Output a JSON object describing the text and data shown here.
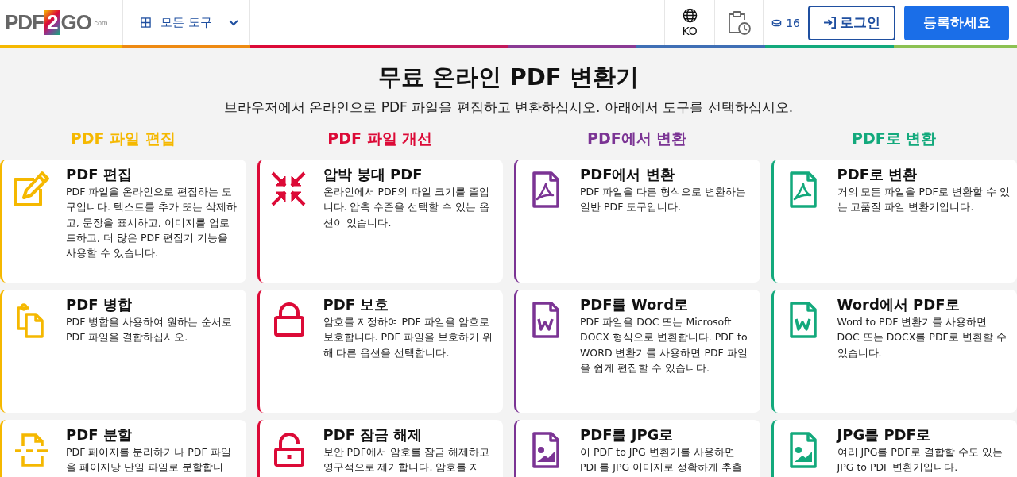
{
  "header": {
    "logo": {
      "text_before": "PDF",
      "badge": "2",
      "text_after": "GO",
      "suffix": ".com"
    },
    "tools_menu": "모든 도구",
    "language": "KO",
    "credits": "16",
    "login": "로그인",
    "signup": "등록하세요"
  },
  "hero": {
    "title": "무료 온라인 PDF 변환기",
    "subtitle": "브라우저에서 온라인으로 PDF 파일을 편집하고 변환하십시오. 아래에서 도구를 선택하십시오."
  },
  "columns": [
    {
      "title": "PDF 파일 편집",
      "color": "#f5b800",
      "tools": [
        {
          "kind": "edit",
          "title": "PDF 편집",
          "description": "PDF 파일을 온라인으로 편집하는 도구입니다. 텍스트를 추가 또는 삭제하고, 문장을 표시하고, 이미지를 업로드하고, 더 많은 PDF 편집기 기능을 사용할 수 있습니다."
        },
        {
          "kind": "merge",
          "title": "PDF 병합",
          "description": "PDF 병합을 사용하여 원하는 순서로 PDF 파일을 결합하십시오."
        },
        {
          "kind": "split",
          "title": "PDF 분할",
          "description": "PDF 페이지를 분리하거나 PDF 파일을 페이지당 단일 파일로 분할합니"
        }
      ]
    },
    {
      "title": "PDF 파일 개선",
      "color": "#dc0a37",
      "tools": [
        {
          "kind": "compress",
          "title": "압박 붕대 PDF",
          "description": "온라인에서 PDF의 파일 크기를 줄입니다. 압축 수준을 선택할 수 있는 옵션이 있습니다."
        },
        {
          "kind": "lock",
          "title": "PDF 보호",
          "description": "암호를 지정하여 PDF 파일을 암호로 보호합니다. PDF 파일을 보호하기 위해 다른 옵션을 선택합니다."
        },
        {
          "kind": "unlock",
          "title": "PDF 잠금 해제",
          "description": "보안 PDF에서 암호를 잠금 해제하고 영구적으로 제거합니다. 암호를 지"
        }
      ]
    },
    {
      "title": "PDF에서 변환",
      "color": "#7b3494",
      "tools": [
        {
          "kind": "pdf",
          "title": "PDF에서 변환",
          "description": "PDF 파일을 다른 형식으로 변환하는 일반 PDF 도구입니다."
        },
        {
          "kind": "word",
          "title": "PDF를 Word로",
          "description": "PDF 파일을 DOC 또는 Microsoft DOCX 형식으로 변환합니다. PDF to WORD 변환기를 사용하면 PDF 파일을 쉽게 편집할 수 있습니다."
        },
        {
          "kind": "image",
          "title": "PDF를 JPG로",
          "description": "이 PDF to JPG 변환기를 사용하면 PDF를 JPG 이미지로 정확하게 추출"
        }
      ]
    },
    {
      "title": "PDF로 변환",
      "color": "#13a97c",
      "tools": [
        {
          "kind": "pdf",
          "title": "PDF로 변환",
          "description": "거의 모든 파일을 PDF로 변환할 수 있는 고품질 파일 변환기입니다."
        },
        {
          "kind": "word",
          "title": "Word에서 PDF로",
          "description": "Word to PDF 변환기를 사용하면 DOC 또는 DOCX를 PDF로 변환할 수 있습니다."
        },
        {
          "kind": "image",
          "title": "JPG를 PDF로",
          "description": "여러 JPG를 PDF로 결합할 수도 있는 JPG to PDF 변환기입니다."
        }
      ]
    }
  ]
}
